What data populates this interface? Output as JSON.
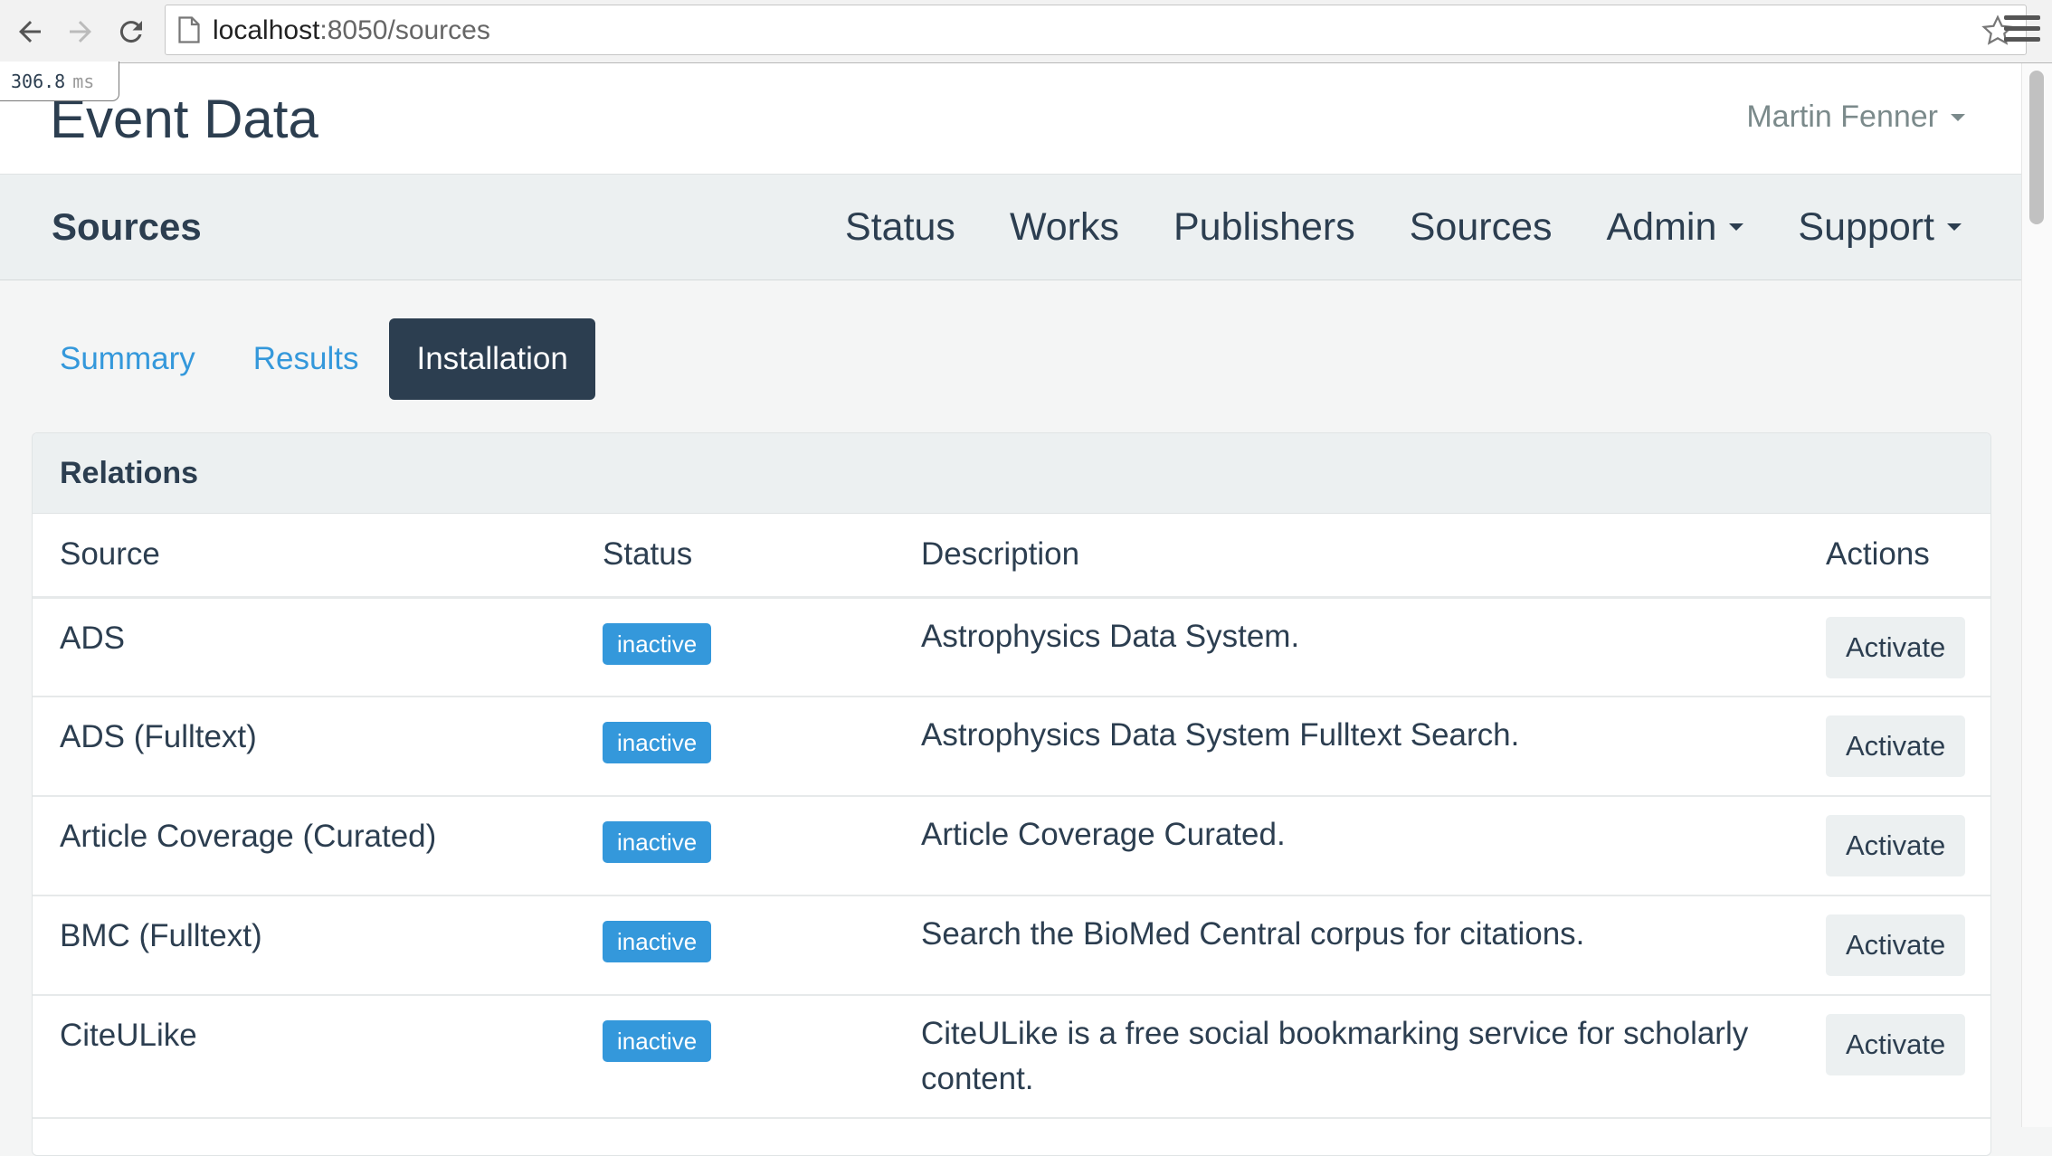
{
  "browser": {
    "url_host": "localhost",
    "url_path": ":8050/sources",
    "icons": [
      "back-arrow-icon",
      "forward-arrow-icon",
      "reload-icon",
      "page-icon",
      "star-icon",
      "menu-icon"
    ]
  },
  "timer": {
    "value": "306.8",
    "unit": "ms"
  },
  "header": {
    "brand": "Event Data",
    "user_name": "Martin Fenner"
  },
  "navbar": {
    "title": "Sources",
    "links": {
      "status": "Status",
      "works": "Works",
      "publishers": "Publishers",
      "sources": "Sources",
      "admin": "Admin",
      "support": "Support"
    }
  },
  "tabs": {
    "summary": "Summary",
    "results": "Results",
    "installation": "Installation"
  },
  "panel": {
    "heading": "Relations",
    "columns": {
      "source": "Source",
      "status": "Status",
      "description": "Description",
      "actions": "Actions"
    },
    "rows": [
      {
        "source": "ADS",
        "status": "inactive",
        "description": "Astrophysics Data System.",
        "action": "Activate"
      },
      {
        "source": "ADS (Fulltext)",
        "status": "inactive",
        "description": "Astrophysics Data System Fulltext Search.",
        "action": "Activate"
      },
      {
        "source": "Article Coverage (Curated)",
        "status": "inactive",
        "description": "Article Coverage Curated.",
        "action": "Activate"
      },
      {
        "source": "BMC (Fulltext)",
        "status": "inactive",
        "description": "Search the BioMed Central corpus for citations.",
        "action": "Activate"
      },
      {
        "source": "CiteULike",
        "status": "inactive",
        "description": "CiteULike is a free social bookmarking service for scholarly content.",
        "action": "Activate"
      }
    ]
  },
  "colors": {
    "primary_dark": "#2c3e50",
    "link_blue": "#3498db",
    "badge_blue": "#3498db",
    "navbar_bg": "#ecf0f1",
    "muted_text": "#7b8a8b"
  }
}
